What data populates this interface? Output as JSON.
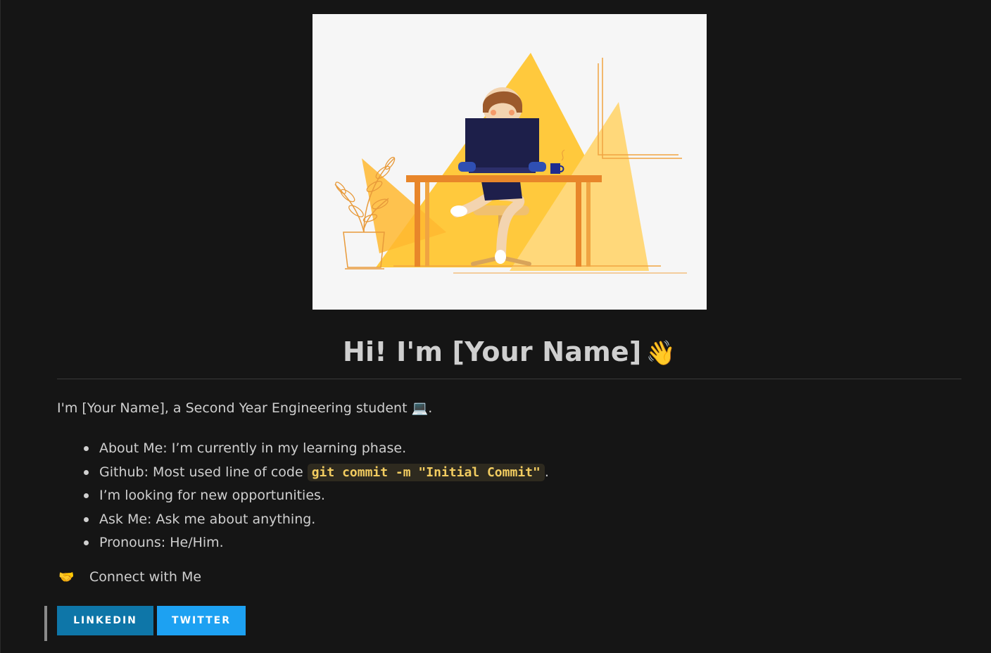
{
  "hero": {
    "alt": "Illustration of a person working at a laptop on a desk"
  },
  "header": {
    "title": "Hi! I'm [Your Name]",
    "title_emoji": "👋"
  },
  "intro": {
    "text": "I'm [Your Name], a Second Year Engineering student",
    "emoji": "💻",
    "suffix": "."
  },
  "list": {
    "items": [
      {
        "text": "About Me: I’m currently in my learning phase."
      },
      {
        "prefix": "Github: Most used line of code ",
        "code": "git commit -m \"Initial Commit\"",
        "suffix": "."
      },
      {
        "text": "I’m looking for new opportunities."
      },
      {
        "text": "Ask Me: Ask me about anything."
      },
      {
        "text": "Pronouns: He/Him."
      }
    ]
  },
  "connect": {
    "emoji": "🤝",
    "label": "Connect with Me"
  },
  "buttons": {
    "linkedin": "LINKEDIN",
    "twitter": "TWITTER"
  },
  "colors": {
    "background": "#151515",
    "linkedin": "#0e76a8",
    "twitter": "#1da1f2",
    "code_text": "#f2cc60"
  }
}
